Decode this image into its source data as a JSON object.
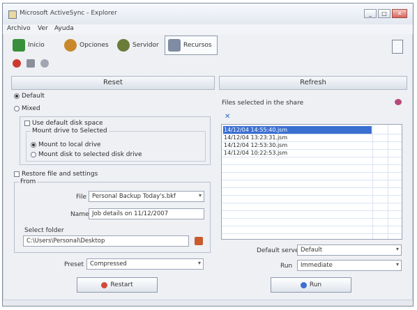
{
  "window": {
    "title": "Microsoft ActiveSync - Explorer",
    "controls": {
      "minimize": "_",
      "maximize": "□",
      "close": "✕"
    }
  },
  "menu": [
    "Archivo",
    "Ver",
    "Ayuda"
  ],
  "toolbar": [
    {
      "label": "Inicio",
      "icon": "home-icon",
      "color": "#3a8f3a"
    },
    {
      "label": "Opciones",
      "icon": "options-icon",
      "color": "#c9892b"
    },
    {
      "label": "Servidor",
      "icon": "server-icon",
      "color": "#6b7c3a"
    },
    {
      "label": "Recursos",
      "icon": "resources-icon",
      "color": "#7f8ca3"
    }
  ],
  "subbar_icons": [
    "stop-icon",
    "play-icon",
    "refresh-icon"
  ],
  "left_panel": {
    "title": "Reset",
    "options": {
      "default": "Default",
      "mixed": "Mixed"
    },
    "use_default_key": "Use default disk space",
    "group_title": "Mount drive to Selected",
    "radio_a": "Mount to local drive",
    "radio_b": "Mount disk to selected disk drive",
    "restore_label": "Restore file and settings",
    "from_group": "From",
    "fields": {
      "file_label": "File",
      "file_value": "Personal Backup Today's.bkf",
      "name_label": "Name",
      "name_value": "Job details on 11/12/2007",
      "folder_label": "Select folder",
      "folder_value": "C:\\Users\\Personal\\Desktop"
    },
    "bottom": {
      "label": "Preset",
      "value": "Compressed"
    },
    "button": "Restart"
  },
  "right_panel": {
    "title": "Refresh",
    "caption": "Files selected in the share",
    "list_items": [
      "14/12/04 14:55:40.jsm",
      "14/12/04 13:23:31.jsm",
      "14/12/04 12:53:30.jsm",
      "14/12/04 10:22:53.jsm"
    ],
    "rows": [
      {
        "label": "Default server",
        "value": "Default"
      },
      {
        "label": "Run",
        "value": "Immediate"
      }
    ],
    "button": "Run"
  }
}
